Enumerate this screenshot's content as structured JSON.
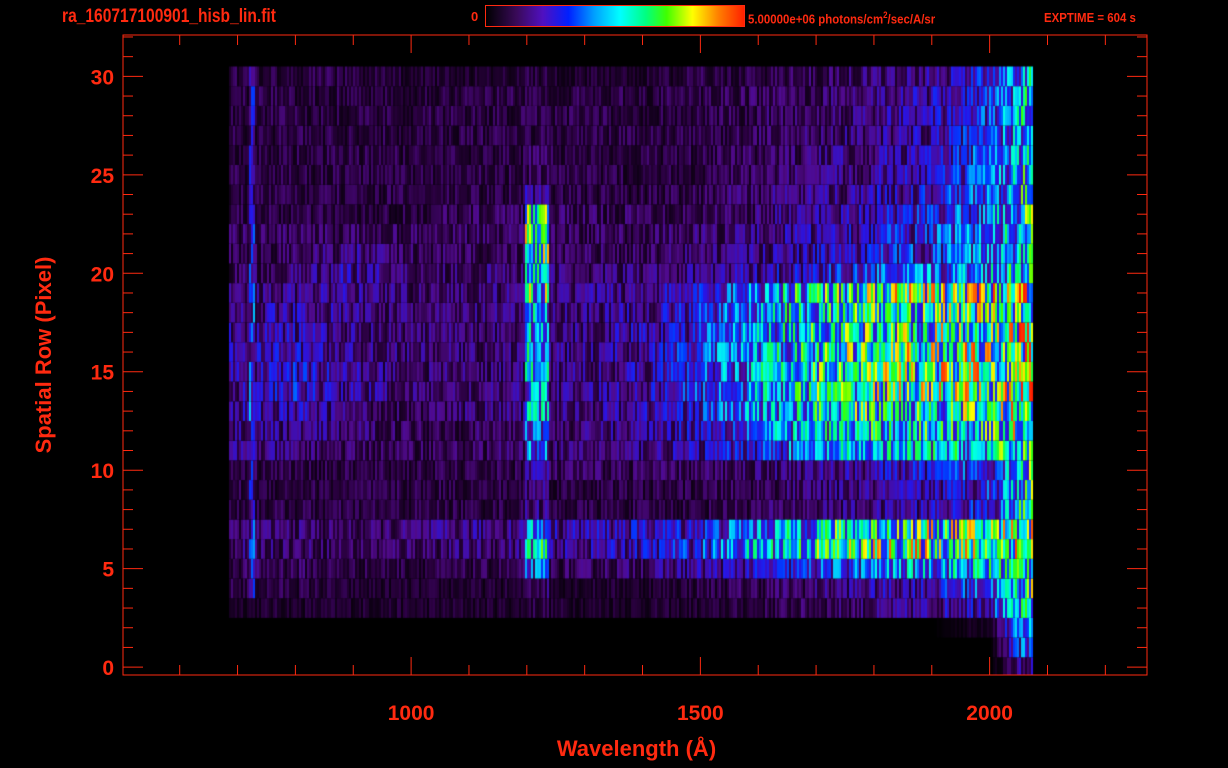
{
  "header": {
    "file_title": "ra_160717100901_hisb_lin.fit",
    "colorbar_min": "0",
    "colorbar_max_label": "5.00000e+06 photons/cm",
    "colorbar_unit_sup": "2",
    "colorbar_unit_rest": "/sec/A/sr",
    "exptime": "EXPTIME = 604 s"
  },
  "colors": {
    "axis": "#ff2a10",
    "background": "#000000"
  },
  "chart_data": {
    "type": "heatmap",
    "title": "ra_160717100901_hisb_lin.fit",
    "xlabel": "Wavelength (Å)",
    "ylabel": "Spatial Row (Pixel)",
    "xlim": [
      502,
      2272
    ],
    "ylim": [
      -0.4,
      32.1
    ],
    "x_ticks": [
      1000,
      1500,
      2000
    ],
    "x_tick_labels": [
      "1000",
      "1500",
      "2000"
    ],
    "y_ticks": [
      0,
      5,
      10,
      15,
      20,
      25,
      30
    ],
    "y_tick_labels": [
      "0",
      "5",
      "10",
      "15",
      "20",
      "25",
      "30"
    ],
    "colorbar_range": [
      0,
      5000000
    ],
    "value_units": "1e6 photons/cm2/sec/A/sr",
    "x_bins": [
      700,
      800,
      900,
      1000,
      1100,
      1216,
      1300,
      1400,
      1500,
      1600,
      1700,
      1800,
      1900,
      2000,
      2060
    ],
    "rows": [
      [
        0,
        0,
        0,
        0,
        0,
        0,
        0,
        0,
        0,
        0,
        0,
        0,
        0,
        0,
        0.8
      ],
      [
        0,
        0,
        0,
        0,
        0,
        0,
        0,
        0,
        0,
        0,
        0,
        0,
        0,
        0,
        1.5
      ],
      [
        0,
        0,
        0,
        0,
        0,
        0,
        0,
        0,
        0,
        0,
        0,
        0,
        0,
        0.3,
        1.8
      ],
      [
        0.3,
        0.3,
        0.3,
        0.3,
        0.3,
        0.4,
        0.3,
        0.3,
        0.3,
        0.4,
        0.5,
        0.6,
        0.8,
        1.2,
        2.2
      ],
      [
        0.4,
        0.4,
        0.3,
        0.3,
        0.3,
        0.6,
        0.3,
        0.3,
        0.4,
        0.5,
        0.6,
        0.8,
        1.0,
        1.5,
        2.6
      ],
      [
        0.5,
        0.5,
        0.4,
        0.4,
        0.4,
        1.4,
        0.5,
        0.6,
        0.8,
        1.0,
        1.3,
        1.6,
        1.9,
        2.2,
        2.8
      ],
      [
        0.6,
        0.6,
        0.5,
        0.6,
        0.6,
        2.2,
        0.8,
        1.0,
        1.3,
        2.0,
        2.6,
        2.9,
        3.0,
        3.0,
        3.4
      ],
      [
        0.6,
        0.6,
        0.5,
        0.6,
        0.7,
        1.8,
        0.9,
        1.0,
        1.2,
        1.7,
        2.3,
        2.6,
        2.8,
        2.9,
        3.2
      ],
      [
        0.4,
        0.4,
        0.4,
        0.4,
        0.4,
        0.7,
        0.4,
        0.4,
        0.4,
        0.5,
        0.6,
        0.7,
        0.9,
        1.2,
        2.4
      ],
      [
        0.4,
        0.4,
        0.4,
        0.4,
        0.4,
        0.7,
        0.4,
        0.4,
        0.4,
        0.5,
        0.6,
        0.7,
        0.9,
        1.3,
        2.5
      ],
      [
        0.5,
        0.4,
        0.4,
        0.4,
        0.4,
        0.9,
        0.5,
        0.5,
        0.5,
        0.6,
        0.7,
        0.9,
        1.1,
        1.5,
        2.6
      ],
      [
        0.7,
        0.6,
        0.5,
        0.5,
        0.5,
        1.6,
        0.6,
        0.7,
        0.9,
        1.3,
        1.7,
        2.0,
        2.1,
        2.2,
        2.8
      ],
      [
        0.7,
        0.7,
        0.6,
        0.5,
        0.5,
        1.8,
        0.6,
        0.8,
        1.1,
        1.6,
        2.1,
        2.3,
        2.4,
        2.5,
        3.0
      ],
      [
        0.8,
        0.9,
        0.6,
        0.5,
        0.6,
        1.9,
        0.7,
        0.9,
        1.2,
        1.8,
        2.3,
        2.6,
        2.6,
        2.7,
        3.2
      ],
      [
        0.8,
        1.1,
        0.8,
        0.6,
        0.6,
        2.0,
        0.7,
        0.9,
        1.3,
        1.9,
        2.5,
        2.8,
        2.9,
        2.9,
        3.4
      ],
      [
        0.8,
        1.1,
        0.8,
        0.6,
        0.6,
        2.0,
        0.7,
        0.9,
        1.3,
        2.0,
        2.6,
        2.9,
        3.0,
        3.0,
        3.5
      ],
      [
        0.8,
        1.0,
        0.7,
        0.6,
        0.6,
        2.0,
        0.7,
        0.9,
        1.3,
        1.9,
        2.5,
        2.8,
        3.0,
        3.0,
        3.5
      ],
      [
        0.8,
        0.9,
        0.7,
        0.6,
        0.6,
        1.9,
        0.7,
        0.9,
        1.2,
        1.8,
        2.4,
        2.7,
        2.8,
        2.9,
        3.4
      ],
      [
        0.7,
        0.9,
        0.7,
        0.6,
        0.6,
        1.9,
        0.7,
        0.8,
        1.2,
        1.8,
        2.4,
        2.6,
        2.7,
        2.8,
        3.2
      ],
      [
        0.6,
        0.7,
        0.8,
        0.6,
        0.6,
        2.6,
        0.7,
        0.8,
        1.1,
        1.8,
        2.6,
        2.9,
        3.0,
        3.0,
        3.3
      ],
      [
        0.5,
        0.6,
        0.9,
        0.6,
        0.6,
        2.8,
        0.6,
        0.6,
        0.7,
        0.9,
        1.1,
        1.3,
        1.6,
        1.9,
        2.8
      ],
      [
        0.5,
        0.5,
        0.7,
        0.5,
        0.5,
        2.7,
        0.5,
        0.5,
        0.6,
        0.7,
        0.9,
        1.1,
        1.3,
        1.7,
        2.6
      ],
      [
        0.5,
        0.5,
        0.5,
        0.5,
        0.5,
        2.8,
        0.5,
        0.5,
        0.6,
        0.7,
        0.9,
        1.1,
        1.3,
        1.7,
        2.6
      ],
      [
        0.4,
        0.4,
        0.4,
        0.4,
        0.5,
        2.6,
        0.5,
        0.5,
        0.5,
        0.6,
        0.8,
        1.0,
        1.2,
        1.6,
        2.5
      ],
      [
        0.4,
        0.4,
        0.4,
        0.4,
        0.4,
        0.8,
        0.4,
        0.4,
        0.5,
        0.6,
        0.7,
        0.9,
        1.1,
        1.5,
        2.4
      ],
      [
        0.4,
        0.4,
        0.4,
        0.4,
        0.4,
        0.5,
        0.4,
        0.4,
        0.4,
        0.5,
        0.6,
        0.8,
        1.0,
        1.4,
        2.3
      ],
      [
        0.4,
        0.4,
        0.4,
        0.4,
        0.4,
        0.5,
        0.4,
        0.4,
        0.4,
        0.5,
        0.6,
        0.8,
        1.0,
        1.4,
        2.3
      ],
      [
        0.4,
        0.4,
        0.4,
        0.4,
        0.4,
        0.4,
        0.4,
        0.4,
        0.4,
        0.5,
        0.6,
        0.7,
        0.9,
        1.3,
        2.2
      ],
      [
        0.4,
        0.4,
        0.4,
        0.4,
        0.4,
        0.4,
        0.4,
        0.4,
        0.4,
        0.5,
        0.6,
        0.7,
        0.9,
        1.3,
        2.2
      ],
      [
        0.4,
        0.4,
        0.4,
        0.4,
        0.4,
        0.4,
        0.4,
        0.4,
        0.4,
        0.5,
        0.5,
        0.7,
        0.9,
        1.2,
        2.1
      ],
      [
        0.4,
        0.4,
        0.4,
        0.3,
        0.3,
        0.4,
        0.3,
        0.3,
        0.4,
        0.4,
        0.5,
        0.6,
        0.8,
        1.2,
        2.0
      ]
    ]
  }
}
